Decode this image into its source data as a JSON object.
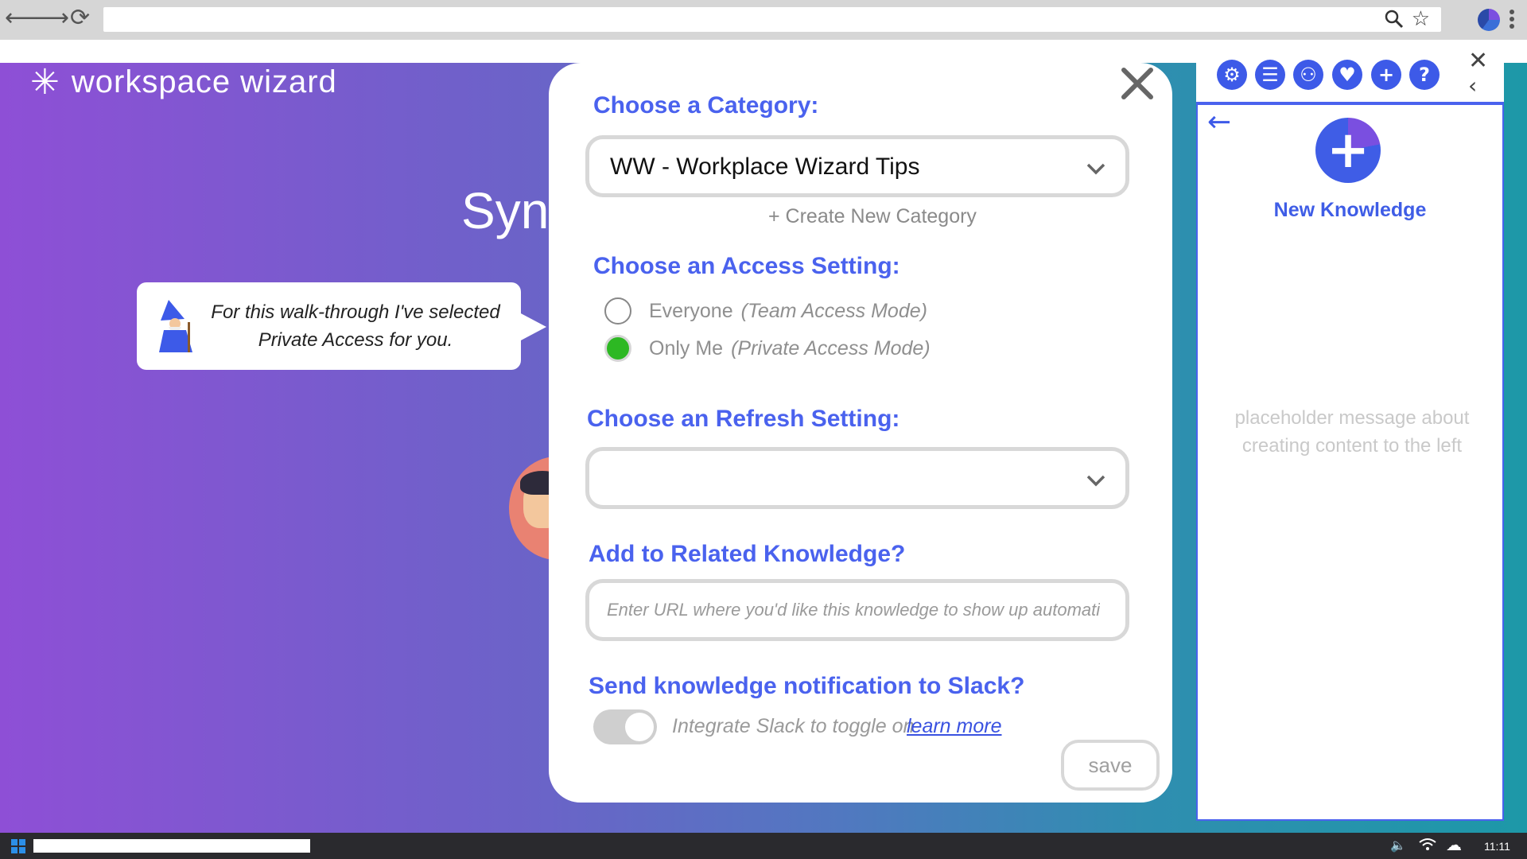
{
  "browser": {
    "back_icon": "⟵",
    "forward_icon": "⟶",
    "reload_icon": "⟳",
    "search_icon": "⌕",
    "star_icon": "☆"
  },
  "background": {
    "brand_name": "workspace wizard",
    "brand_icon": "✳",
    "heading": "Sync"
  },
  "bubble": {
    "line1": "For this walk-through I've selected",
    "line2": "Private Access for you."
  },
  "modal": {
    "close_icon": "✕",
    "category_label": "Choose a Category:",
    "category_value": "WW - Workplace Wizard Tips",
    "create_category": "+  Create New Category",
    "access_label": "Choose an Access Setting:",
    "access_options": [
      {
        "label": "Everyone",
        "hint": "(Team Access Mode)",
        "checked": false
      },
      {
        "label": "Only Me",
        "hint": "(Private Access Mode)",
        "checked": true
      }
    ],
    "refresh_label": "Choose an Refresh Setting:",
    "refresh_value": "",
    "related_label": "Add to Related Knowledge?",
    "related_placeholder": "Enter URL where you'd like this knowledge to show up automatically",
    "slack_label": "Send knowledge notification to Slack?",
    "slack_hint": "Integrate Slack to toggle on",
    "learn_more": "learn more",
    "save_label": "save",
    "accent_color": "#4a62ee",
    "selected_color": "#2db823"
  },
  "side_panel": {
    "toolbar_icons": [
      {
        "name": "gear-icon",
        "glyph": "⚙"
      },
      {
        "name": "list-icon",
        "glyph": "☰"
      },
      {
        "name": "team-icon",
        "glyph": "⚇"
      },
      {
        "name": "heart-icon",
        "glyph": "♥"
      },
      {
        "name": "plus-icon",
        "glyph": "+"
      },
      {
        "name": "help-icon",
        "glyph": "?"
      }
    ],
    "close_icon": "✕",
    "collapse_icon": "‹",
    "back_arrow_icon": "←",
    "new_knowledge_icon": "+",
    "new_knowledge_label": "New Knowledge",
    "placeholder_message": "placeholder message about creating content to the left"
  },
  "taskbar": {
    "clock": "11:11",
    "volume_icon": "🔈",
    "wifi_icon": "wifi-icon",
    "cloud_icon": "☁"
  }
}
